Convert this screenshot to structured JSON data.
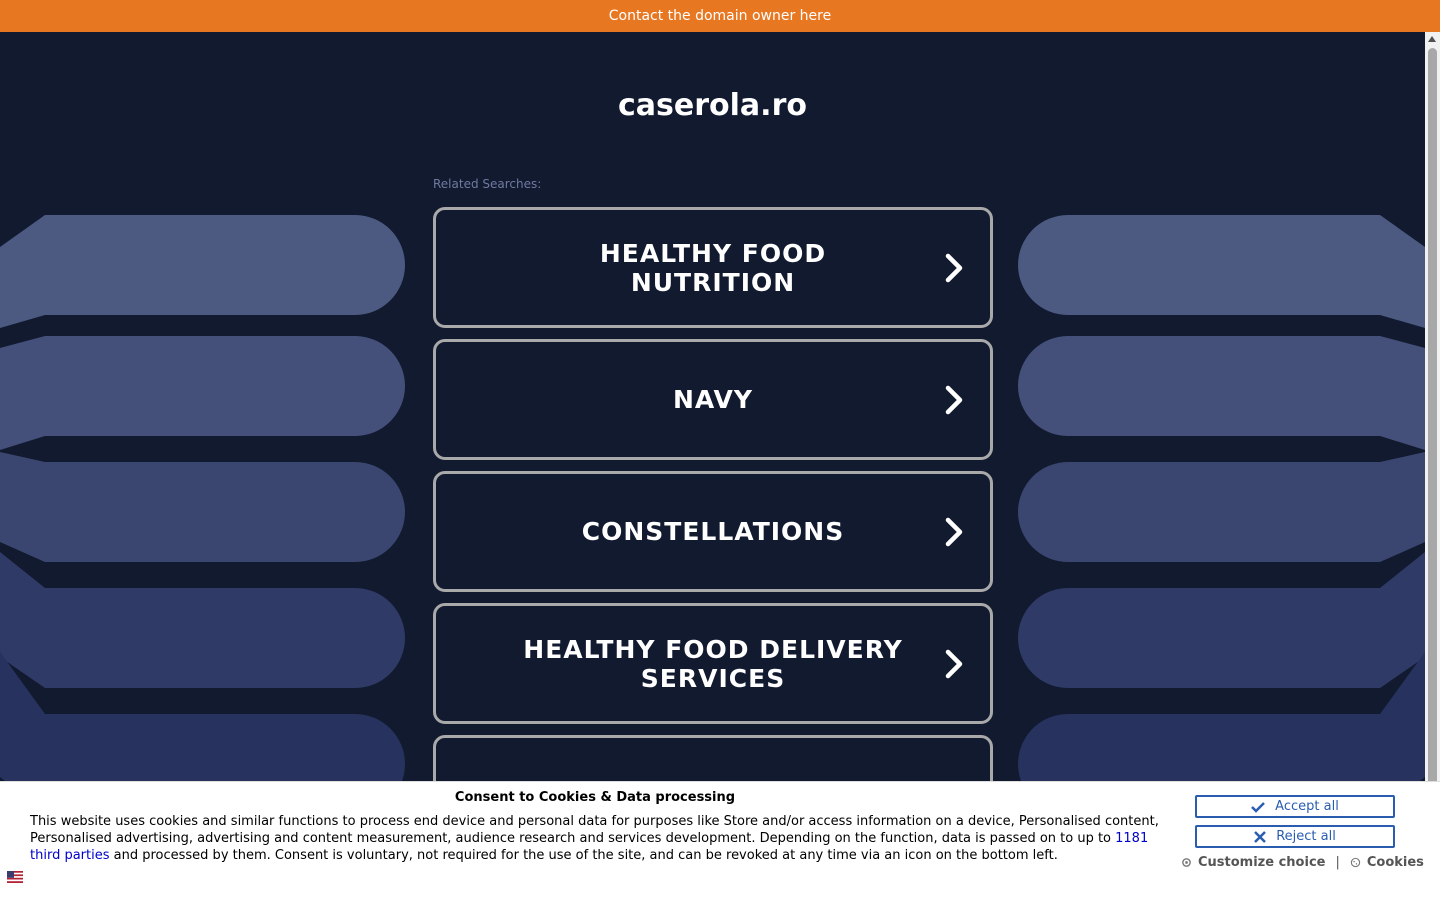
{
  "topbar": {
    "text": "Contact the domain owner here"
  },
  "header": {
    "domain": "caserola.ro"
  },
  "related": {
    "label": "Related Searches:",
    "items": [
      {
        "label": "HEALTHY FOOD NUTRITION"
      },
      {
        "label": "NAVY"
      },
      {
        "label": "CONSTELLATIONS"
      },
      {
        "label": "HEALTHY FOOD DELIVERY SERVICES"
      },
      {
        "label": ""
      }
    ]
  },
  "consent": {
    "title": "Consent to Cookies & Data processing",
    "body_before": "This website uses cookies and similar functions to process end device and personal data for purposes like Store and/or access information on a device, Personalised content, Personalised advertising, advertising and content measurement, audience research and services development. Depending on the function, data is passed on to up to ",
    "link": "1181 third parties",
    "body_after": " and processed by them. Consent is voluntary, not required for the use of the site, and can be revoked at any time via an icon on the bottom left.",
    "accept_label": "Accept all",
    "reject_label": "Reject all",
    "customize_label": "Customize choice",
    "separator": "|",
    "cookies_label": "Cookies"
  },
  "colors": {
    "topbar": "#e87722",
    "background": "#121a30",
    "accent": "#2a5db0"
  },
  "icons": [
    "chevron-right-icon",
    "check-icon",
    "x-icon",
    "gear-icon",
    "cookie-icon",
    "flag-icon"
  ]
}
